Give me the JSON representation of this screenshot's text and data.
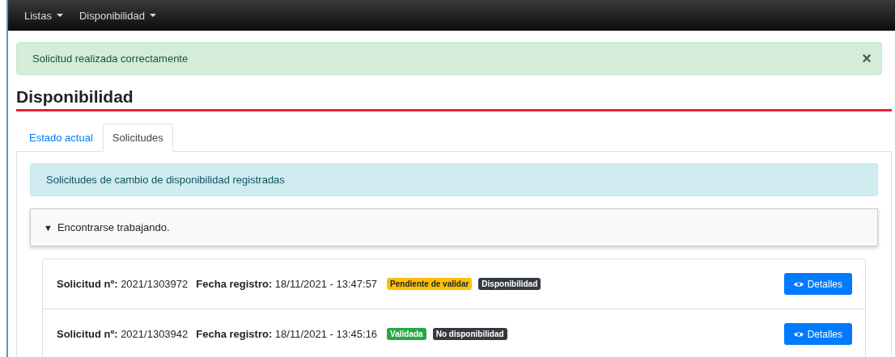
{
  "navbar": {
    "menus": [
      {
        "label": "Listas"
      },
      {
        "label": "Disponibilidad"
      }
    ]
  },
  "alert": {
    "message": "Solicitud realizada correctamente",
    "close": "×"
  },
  "page_title": "Disponibilidad",
  "tabs": [
    {
      "label": "Estado actual",
      "selected": false
    },
    {
      "label": "Solicitudes",
      "selected": true
    }
  ],
  "info": "Solicitudes de cambio de disponibilidad registradas",
  "group": {
    "toggle": "▼",
    "title": "Encontrarse trabajando.",
    "expanded": true,
    "requests": [
      {
        "number_label": "Solicitud nº:",
        "number": "2021/1303972",
        "date_label": "Fecha registro:",
        "date": "18/11/2021 - 13:47:57",
        "badges": [
          {
            "text": "Pendiente de validar",
            "color": "#ffc107"
          },
          {
            "text": "Disponibilidad",
            "color": "#343a40"
          }
        ],
        "button": "Detalles"
      },
      {
        "number_label": "Solicitud nº:",
        "number": "2021/1303942",
        "date_label": "Fecha registro:",
        "date": "18/11/2021 - 13:45:16",
        "badges": [
          {
            "text": "Validada",
            "color": "#28a745"
          },
          {
            "text": "No disponibilidad",
            "color": "#343a40"
          }
        ],
        "button": "Detalles"
      }
    ]
  }
}
